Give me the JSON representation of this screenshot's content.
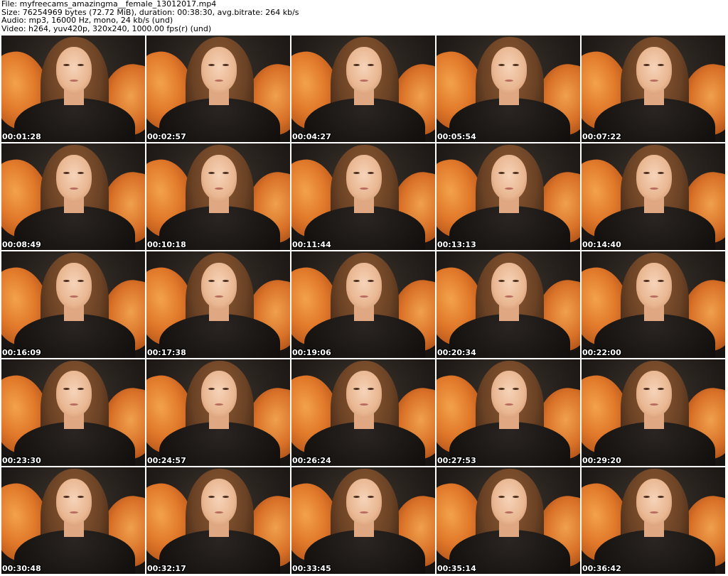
{
  "header": {
    "file": "File: myfreecams_amazingma__female_13012017.mp4",
    "size": "Size: 76254969 bytes (72.72 MiB), duration: 00:38:30, avg.bitrate: 264 kb/s",
    "audio": "Audio: mp3, 16000 Hz, mono, 24 kb/s (und)",
    "video": "Video: h264, yuv420p, 320x240, 1000.00 fps(r) (und)"
  },
  "thumbnails": [
    {
      "timestamp": "00:01:28"
    },
    {
      "timestamp": "00:02:57"
    },
    {
      "timestamp": "00:04:27"
    },
    {
      "timestamp": "00:05:54"
    },
    {
      "timestamp": "00:07:22"
    },
    {
      "timestamp": "00:08:49"
    },
    {
      "timestamp": "00:10:18"
    },
    {
      "timestamp": "00:11:44"
    },
    {
      "timestamp": "00:13:13"
    },
    {
      "timestamp": "00:14:40"
    },
    {
      "timestamp": "00:16:09"
    },
    {
      "timestamp": "00:17:38"
    },
    {
      "timestamp": "00:19:06"
    },
    {
      "timestamp": "00:20:34"
    },
    {
      "timestamp": "00:22:00"
    },
    {
      "timestamp": "00:23:30"
    },
    {
      "timestamp": "00:24:57"
    },
    {
      "timestamp": "00:26:24"
    },
    {
      "timestamp": "00:27:53"
    },
    {
      "timestamp": "00:29:20"
    },
    {
      "timestamp": "00:30:48"
    },
    {
      "timestamp": "00:32:17"
    },
    {
      "timestamp": "00:33:45"
    },
    {
      "timestamp": "00:35:14"
    },
    {
      "timestamp": "00:36:42"
    }
  ]
}
